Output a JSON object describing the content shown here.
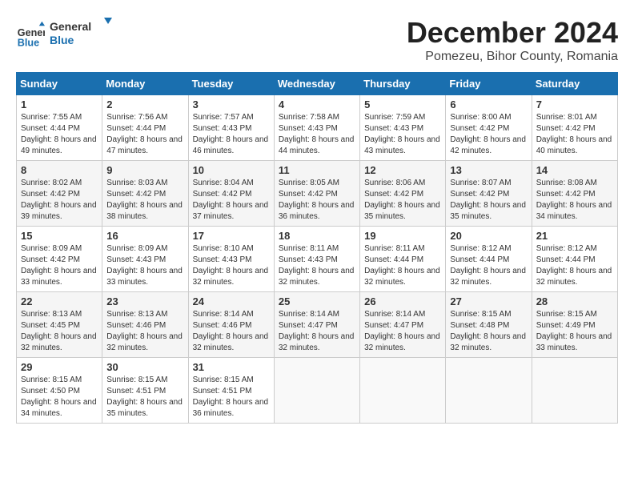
{
  "logo": {
    "text_general": "General",
    "text_blue": "Blue"
  },
  "title": "December 2024",
  "subtitle": "Pomezeu, Bihor County, Romania",
  "days_header": [
    "Sunday",
    "Monday",
    "Tuesday",
    "Wednesday",
    "Thursday",
    "Friday",
    "Saturday"
  ],
  "weeks": [
    [
      {
        "day": "1",
        "sunrise": "7:55 AM",
        "sunset": "4:44 PM",
        "daylight": "8 hours and 49 minutes."
      },
      {
        "day": "2",
        "sunrise": "7:56 AM",
        "sunset": "4:44 PM",
        "daylight": "8 hours and 47 minutes."
      },
      {
        "day": "3",
        "sunrise": "7:57 AM",
        "sunset": "4:43 PM",
        "daylight": "8 hours and 46 minutes."
      },
      {
        "day": "4",
        "sunrise": "7:58 AM",
        "sunset": "4:43 PM",
        "daylight": "8 hours and 44 minutes."
      },
      {
        "day": "5",
        "sunrise": "7:59 AM",
        "sunset": "4:43 PM",
        "daylight": "8 hours and 43 minutes."
      },
      {
        "day": "6",
        "sunrise": "8:00 AM",
        "sunset": "4:42 PM",
        "daylight": "8 hours and 42 minutes."
      },
      {
        "day": "7",
        "sunrise": "8:01 AM",
        "sunset": "4:42 PM",
        "daylight": "8 hours and 40 minutes."
      }
    ],
    [
      {
        "day": "8",
        "sunrise": "8:02 AM",
        "sunset": "4:42 PM",
        "daylight": "8 hours and 39 minutes."
      },
      {
        "day": "9",
        "sunrise": "8:03 AM",
        "sunset": "4:42 PM",
        "daylight": "8 hours and 38 minutes."
      },
      {
        "day": "10",
        "sunrise": "8:04 AM",
        "sunset": "4:42 PM",
        "daylight": "8 hours and 37 minutes."
      },
      {
        "day": "11",
        "sunrise": "8:05 AM",
        "sunset": "4:42 PM",
        "daylight": "8 hours and 36 minutes."
      },
      {
        "day": "12",
        "sunrise": "8:06 AM",
        "sunset": "4:42 PM",
        "daylight": "8 hours and 35 minutes."
      },
      {
        "day": "13",
        "sunrise": "8:07 AM",
        "sunset": "4:42 PM",
        "daylight": "8 hours and 35 minutes."
      },
      {
        "day": "14",
        "sunrise": "8:08 AM",
        "sunset": "4:42 PM",
        "daylight": "8 hours and 34 minutes."
      }
    ],
    [
      {
        "day": "15",
        "sunrise": "8:09 AM",
        "sunset": "4:42 PM",
        "daylight": "8 hours and 33 minutes."
      },
      {
        "day": "16",
        "sunrise": "8:09 AM",
        "sunset": "4:43 PM",
        "daylight": "8 hours and 33 minutes."
      },
      {
        "day": "17",
        "sunrise": "8:10 AM",
        "sunset": "4:43 PM",
        "daylight": "8 hours and 32 minutes."
      },
      {
        "day": "18",
        "sunrise": "8:11 AM",
        "sunset": "4:43 PM",
        "daylight": "8 hours and 32 minutes."
      },
      {
        "day": "19",
        "sunrise": "8:11 AM",
        "sunset": "4:44 PM",
        "daylight": "8 hours and 32 minutes."
      },
      {
        "day": "20",
        "sunrise": "8:12 AM",
        "sunset": "4:44 PM",
        "daylight": "8 hours and 32 minutes."
      },
      {
        "day": "21",
        "sunrise": "8:12 AM",
        "sunset": "4:44 PM",
        "daylight": "8 hours and 32 minutes."
      }
    ],
    [
      {
        "day": "22",
        "sunrise": "8:13 AM",
        "sunset": "4:45 PM",
        "daylight": "8 hours and 32 minutes."
      },
      {
        "day": "23",
        "sunrise": "8:13 AM",
        "sunset": "4:46 PM",
        "daylight": "8 hours and 32 minutes."
      },
      {
        "day": "24",
        "sunrise": "8:14 AM",
        "sunset": "4:46 PM",
        "daylight": "8 hours and 32 minutes."
      },
      {
        "day": "25",
        "sunrise": "8:14 AM",
        "sunset": "4:47 PM",
        "daylight": "8 hours and 32 minutes."
      },
      {
        "day": "26",
        "sunrise": "8:14 AM",
        "sunset": "4:47 PM",
        "daylight": "8 hours and 32 minutes."
      },
      {
        "day": "27",
        "sunrise": "8:15 AM",
        "sunset": "4:48 PM",
        "daylight": "8 hours and 32 minutes."
      },
      {
        "day": "28",
        "sunrise": "8:15 AM",
        "sunset": "4:49 PM",
        "daylight": "8 hours and 33 minutes."
      }
    ],
    [
      {
        "day": "29",
        "sunrise": "8:15 AM",
        "sunset": "4:50 PM",
        "daylight": "8 hours and 34 minutes."
      },
      {
        "day": "30",
        "sunrise": "8:15 AM",
        "sunset": "4:51 PM",
        "daylight": "8 hours and 35 minutes."
      },
      {
        "day": "31",
        "sunrise": "8:15 AM",
        "sunset": "4:51 PM",
        "daylight": "8 hours and 36 minutes."
      },
      null,
      null,
      null,
      null
    ]
  ],
  "labels": {
    "sunrise": "Sunrise:",
    "sunset": "Sunset:",
    "daylight": "Daylight:"
  }
}
